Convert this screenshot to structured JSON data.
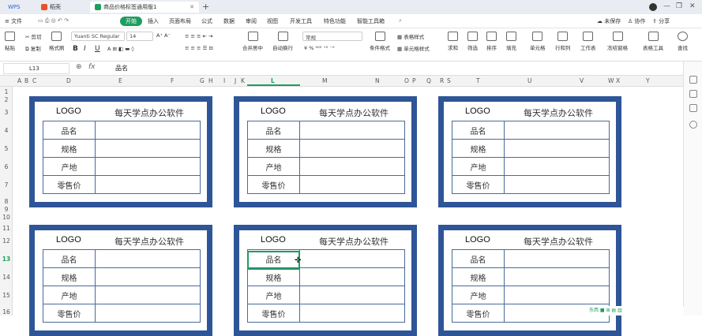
{
  "titlebar": {
    "tabs": [
      {
        "label": "WPS",
        "color": "#2a63d8"
      },
      {
        "label": "稻壳",
        "color": "#e5532d"
      },
      {
        "label": "商品价格标签通用版1",
        "color": "#1e9e5e"
      }
    ],
    "window_controls": [
      "—",
      "❐",
      "✕"
    ]
  },
  "menubar": {
    "file_label": "文件",
    "items": [
      "开始",
      "插入",
      "页面布局",
      "公式",
      "数据",
      "审阅",
      "视图",
      "开发工具",
      "特色功能",
      "智能工具箱"
    ],
    "search_icon": "search-icon",
    "right": [
      "未保存",
      "协作",
      "分享"
    ]
  },
  "ribbon": {
    "paste": "粘贴",
    "cut": "剪切",
    "copy": "复制",
    "format_painter": "格式刷",
    "font_name": "Yuanti SC Regular",
    "font_size": "14",
    "merge_center": "合并居中",
    "wrap": "自动换行",
    "number_format": "常规",
    "conditional": "条件格式",
    "table_style": "表格样式",
    "cell_style": "单元格样式",
    "sum": "求和",
    "filter": "筛选",
    "sort": "排序",
    "fill": "填充",
    "cell": "单元格",
    "rowcol": "行和列",
    "sheet": "工作表",
    "freeze": "冻结窗格",
    "table_tools": "表格工具",
    "find": "查找"
  },
  "formula": {
    "cell_ref": "L13",
    "fx": "fx",
    "value": "品名"
  },
  "columns": [
    "A",
    "B",
    "C",
    "D",
    "E",
    "F",
    "G",
    "H",
    "I",
    "J",
    "K",
    "L",
    "M",
    "N",
    "O",
    "P",
    "Q",
    "R",
    "S",
    "T",
    "U",
    "V",
    "W",
    "X",
    "Y"
  ],
  "rows": [
    "1",
    "2",
    "3",
    "4",
    "5",
    "6",
    "7",
    "8",
    "9",
    "10",
    "11",
    "12",
    "13",
    "14",
    "15",
    "16"
  ],
  "label_template": {
    "logo": "LOGO",
    "slogan": "每天学点办公软件",
    "fields": [
      "品名",
      "规格",
      "产地",
      "零售价"
    ]
  },
  "status": {
    "watermark": "东西 ■ ⊞ ▤ ▥"
  },
  "colors": {
    "accent": "#1e9e5e",
    "frame": "#2e5597"
  }
}
